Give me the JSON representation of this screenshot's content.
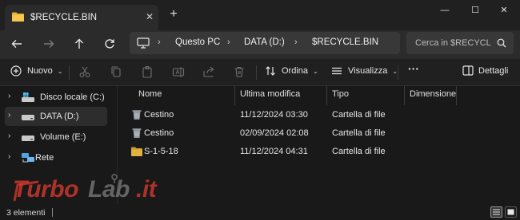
{
  "tab": {
    "title": "$RECYCLE.BIN",
    "close": "✕",
    "new": "+"
  },
  "window": {
    "minimize": "—",
    "maximize": "☐",
    "close": "✕"
  },
  "address": {
    "crumbs": [
      "Questo PC",
      "DATA (D:)",
      "$RECYCLE.BIN"
    ],
    "separator": "›"
  },
  "search": {
    "placeholder": "Cerca in $RECYCL"
  },
  "toolbar": {
    "new_label": "Nuovo",
    "sort_label": "Ordina",
    "view_label": "Visualizza",
    "more_label": "···",
    "details_label": "Dettagli"
  },
  "sidebar": {
    "items": [
      {
        "label": "Disco locale (C:)",
        "icon": "windows-drive-icon",
        "selected": false
      },
      {
        "label": "DATA (D:)",
        "icon": "drive-icon",
        "selected": true
      },
      {
        "label": "Volume (E:)",
        "icon": "drive-icon",
        "selected": false
      },
      {
        "label": "Rete",
        "icon": "network-icon",
        "selected": false
      }
    ]
  },
  "columns": {
    "name": "Nome",
    "modified": "Ultima modifica",
    "type": "Tipo",
    "size": "Dimensione"
  },
  "files": [
    {
      "name": "Cestino",
      "modified": "11/12/2024 03:30",
      "type": "Cartella di file",
      "size": "",
      "icon": "recycle-bin-icon"
    },
    {
      "name": "Cestino",
      "modified": "02/09/2024 02:08",
      "type": "Cartella di file",
      "size": "",
      "icon": "recycle-bin-icon"
    },
    {
      "name": "S-1-5-18",
      "modified": "11/12/2024 04:31",
      "type": "Cartella di file",
      "size": "",
      "icon": "folder-icon"
    }
  ],
  "status": {
    "count": "3 elementi"
  },
  "watermark": {
    "text": "TurboLab.it"
  },
  "colors": {
    "accent": "#60cdff",
    "folder": "#e8b33d",
    "watermark_red": "#d83a2e"
  }
}
